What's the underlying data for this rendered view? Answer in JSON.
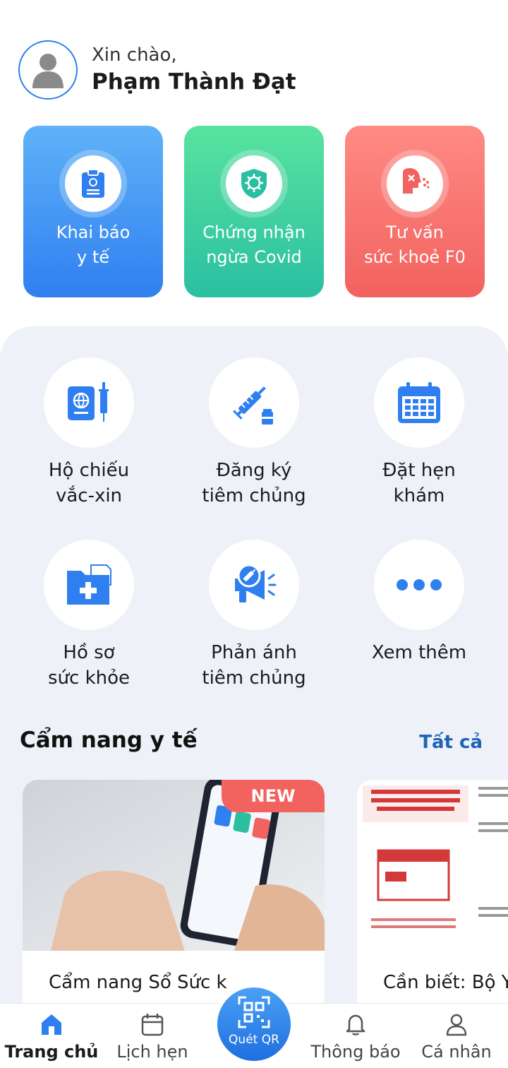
{
  "header": {
    "greeting": "Xin chào,",
    "user_name": "Phạm Thành Đạt"
  },
  "top_cards": [
    {
      "label_line1": "Khai báo",
      "label_line2": "y tế",
      "icon": "clipboard-icon",
      "color": "#2f7ff0"
    },
    {
      "label_line1": "Chứng nhận",
      "label_line2": "ngừa Covid",
      "icon": "virus-shield-icon",
      "color": "#2bbfa2"
    },
    {
      "label_line1": "Tư vấn",
      "label_line2": "sức khoẻ F0",
      "icon": "cough-icon",
      "color": "#f2625e"
    }
  ],
  "services": [
    {
      "line1": "Hộ chiếu",
      "line2": "vắc-xin",
      "icon": "passport-syringe-icon"
    },
    {
      "line1": "Đăng ký",
      "line2": "tiêm chủng",
      "icon": "syringe-vial-icon"
    },
    {
      "line1": "Đặt hẹn",
      "line2": "khám",
      "icon": "calendar-icon"
    },
    {
      "line1": "Hồ sơ",
      "line2": "sức khỏe",
      "icon": "medical-folder-icon"
    },
    {
      "line1": "Phản ánh",
      "line2": "tiêm chủng",
      "icon": "megaphone-icon"
    },
    {
      "line1": "Xem thêm",
      "line2": "",
      "icon": "more-dots-icon"
    }
  ],
  "handbook": {
    "title": "Cẩm nang y tế",
    "see_all": "Tất cả",
    "articles": [
      {
        "title": "Cẩm nang Sổ Sức k",
        "badge": "NEW"
      },
      {
        "title": "Cần biết: Bộ Y"
      }
    ]
  },
  "bottom_nav": {
    "home": "Trang chủ",
    "schedule": "Lịch hẹn",
    "qr": "Quét QR",
    "notifications": "Thông báo",
    "profile": "Cá nhân"
  },
  "colors": {
    "accent": "#2f80ed",
    "link": "#1f63b6",
    "panel_bg": "#eef1f7"
  }
}
